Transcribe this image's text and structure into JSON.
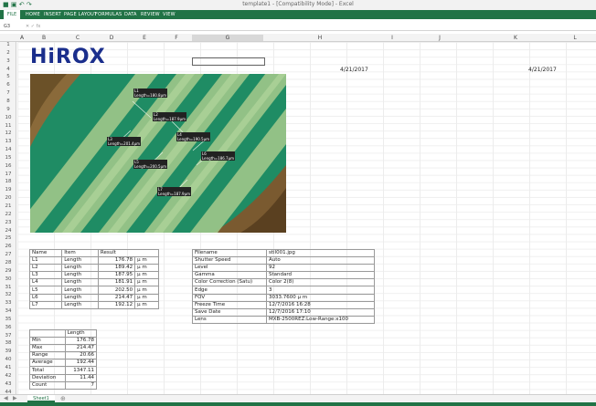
{
  "window": {
    "title": "template1 - [Compatibility Mode] - Excel"
  },
  "ribbon": {
    "file": "FILE",
    "tabs": [
      "HOME",
      "INSERT",
      "PAGE LAYOUT",
      "FORMULAS",
      "DATA",
      "REVIEW",
      "VIEW"
    ]
  },
  "formula_bar": {
    "name_box": "G3",
    "fx": "fx"
  },
  "columns": [
    "A",
    "B",
    "C",
    "D",
    "E",
    "F",
    "G",
    "H",
    "I",
    "J",
    "K",
    "L"
  ],
  "rows": [
    "1",
    "2",
    "3",
    "4",
    "5",
    "6",
    "7",
    "8",
    "9",
    "10",
    "11",
    "12",
    "13",
    "14",
    "15",
    "16",
    "17",
    "18",
    "19",
    "20",
    "21",
    "22",
    "23",
    "24",
    "25",
    "26",
    "27",
    "28",
    "29",
    "30",
    "31",
    "32",
    "33",
    "34",
    "35",
    "36",
    "37",
    "38",
    "39",
    "40",
    "41",
    "42",
    "43",
    "44"
  ],
  "logo": "HiROX",
  "dates": {
    "h4": "4/21/2017",
    "k4": "4/21/2017"
  },
  "measurements": [
    {
      "label": "L1",
      "text": "Length=180.8µm"
    },
    {
      "label": "L2",
      "text": "Length=187.9µm"
    },
    {
      "label": "L3",
      "text": "Length=201.4µm"
    },
    {
      "label": "L4",
      "text": "Length=190.5µm"
    },
    {
      "label": "L5",
      "text": "Length=200.5µm"
    },
    {
      "label": "L6",
      "text": "Length=186.7µm"
    },
    {
      "label": "L7",
      "text": "Length=187.9µm"
    }
  ],
  "results_table": {
    "headers": [
      "Name",
      "Item",
      "Result"
    ],
    "rows": [
      [
        "L1",
        "Length",
        "176.78",
        "μ m"
      ],
      [
        "L2",
        "Length",
        "189.42",
        "μ m"
      ],
      [
        "L3",
        "Length",
        "187.95",
        "μ m"
      ],
      [
        "L4",
        "Length",
        "181.91",
        "μ m"
      ],
      [
        "L5",
        "Length",
        "202.50",
        "μ m"
      ],
      [
        "L6",
        "Length",
        "214.47",
        "μ m"
      ],
      [
        "L7",
        "Length",
        "192.12",
        "μ m"
      ]
    ]
  },
  "stats_table": {
    "header": "Length",
    "rows": [
      [
        "Min",
        "176.78"
      ],
      [
        "Max",
        "214.47"
      ],
      [
        "Range",
        "20.66"
      ],
      [
        "Average",
        "192.44"
      ],
      [
        "Total",
        "1347.11"
      ],
      [
        "Deviation",
        "11.44"
      ],
      [
        "Count",
        "7"
      ]
    ]
  },
  "info_table": {
    "rows": [
      [
        "Filename",
        "stil001.jpg"
      ],
      [
        "Shutter Speed",
        "Auto"
      ],
      [
        "Level",
        "92"
      ],
      [
        "Gamma",
        "Standard"
      ],
      [
        "Color Correction (Satu)",
        "Color 2(8)"
      ],
      [
        "Edge",
        "3"
      ],
      [
        "FOV",
        "3033.7600 μ m"
      ],
      [
        "Freeze Time",
        "12/7/2016 16:28"
      ],
      [
        "Save Date",
        "12/7/2016 17:10"
      ],
      [
        "Lens",
        "MXB-2500REZ:Low-Range:x100"
      ]
    ]
  },
  "sheet_tabs": [
    "Sheet1"
  ],
  "colors": {
    "excel_green": "#217346",
    "logo_blue": "#1a2e8c"
  }
}
